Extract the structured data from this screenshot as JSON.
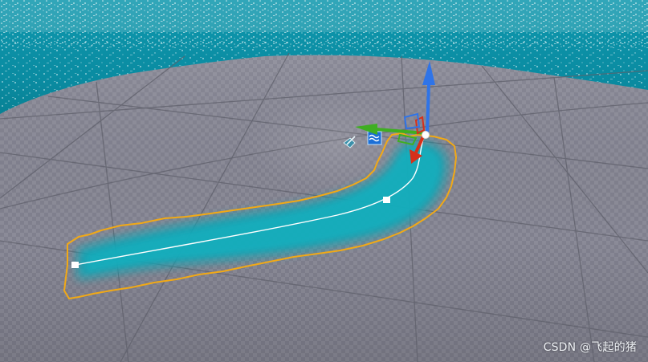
{
  "viewport": {
    "watermark": "CSDN @飞起的猪"
  },
  "colors": {
    "ocean": "#0a8fa6",
    "ocean_deep": "#06707f",
    "ground": "#8c8c99",
    "ground_dark": "#6f707b",
    "river_water": "#13a6b4",
    "selection_outline": "#f0a818",
    "spline": "#ffffff",
    "gizmo_z": "#2f74e8",
    "gizmo_y": "#3fae22",
    "gizmo_x": "#d6301a"
  },
  "icons": {
    "water_actor": "water-body-icon",
    "light_probe": "reflection-capture-icon",
    "spline_point": "spline-point-handle",
    "gizmo": "transform-gizmo"
  }
}
